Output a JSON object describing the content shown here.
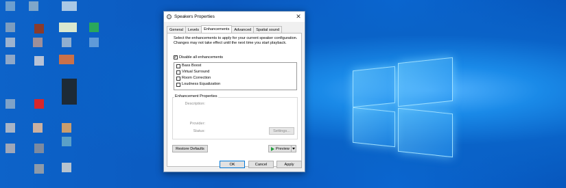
{
  "window": {
    "title": "Speakers Properties",
    "close_glyph": "✕"
  },
  "tabs": [
    {
      "label": "General"
    },
    {
      "label": "Levels"
    },
    {
      "label": "Enhancements"
    },
    {
      "label": "Advanced"
    },
    {
      "label": "Spatial sound"
    }
  ],
  "active_tab": "Enhancements",
  "description": "Select the enhancements to apply for your current speaker configuration. Changes may not take effect until the next time you start playback.",
  "disable_all": {
    "label": "Disable all enhancements",
    "checked": true
  },
  "enhancements": [
    {
      "label": "Bass Boost",
      "checked": false
    },
    {
      "label": "Virtual Surround",
      "checked": false
    },
    {
      "label": "Room Correction",
      "checked": false
    },
    {
      "label": "Loudness Equalization",
      "checked": false
    }
  ],
  "properties_group": {
    "title": "Enhancement Properties",
    "description_label": "Description:",
    "provider_label": "Provider:",
    "status_label": "Status:",
    "settings_button": "Settings..."
  },
  "buttons": {
    "restore_defaults": "Restore Defaults",
    "preview": "Preview",
    "ok": "OK",
    "cancel": "Cancel",
    "apply": "Apply"
  },
  "icons": {
    "window_icon": "speaker-icon",
    "preview_icon": "play-icon",
    "dropdown_icon": "chevron-down-icon"
  },
  "colors": {
    "desktop_blue": "#0a63c8",
    "dialog_bg": "#f0f0f0",
    "accent": "#0078d7",
    "play_green": "#1e9e3a"
  }
}
